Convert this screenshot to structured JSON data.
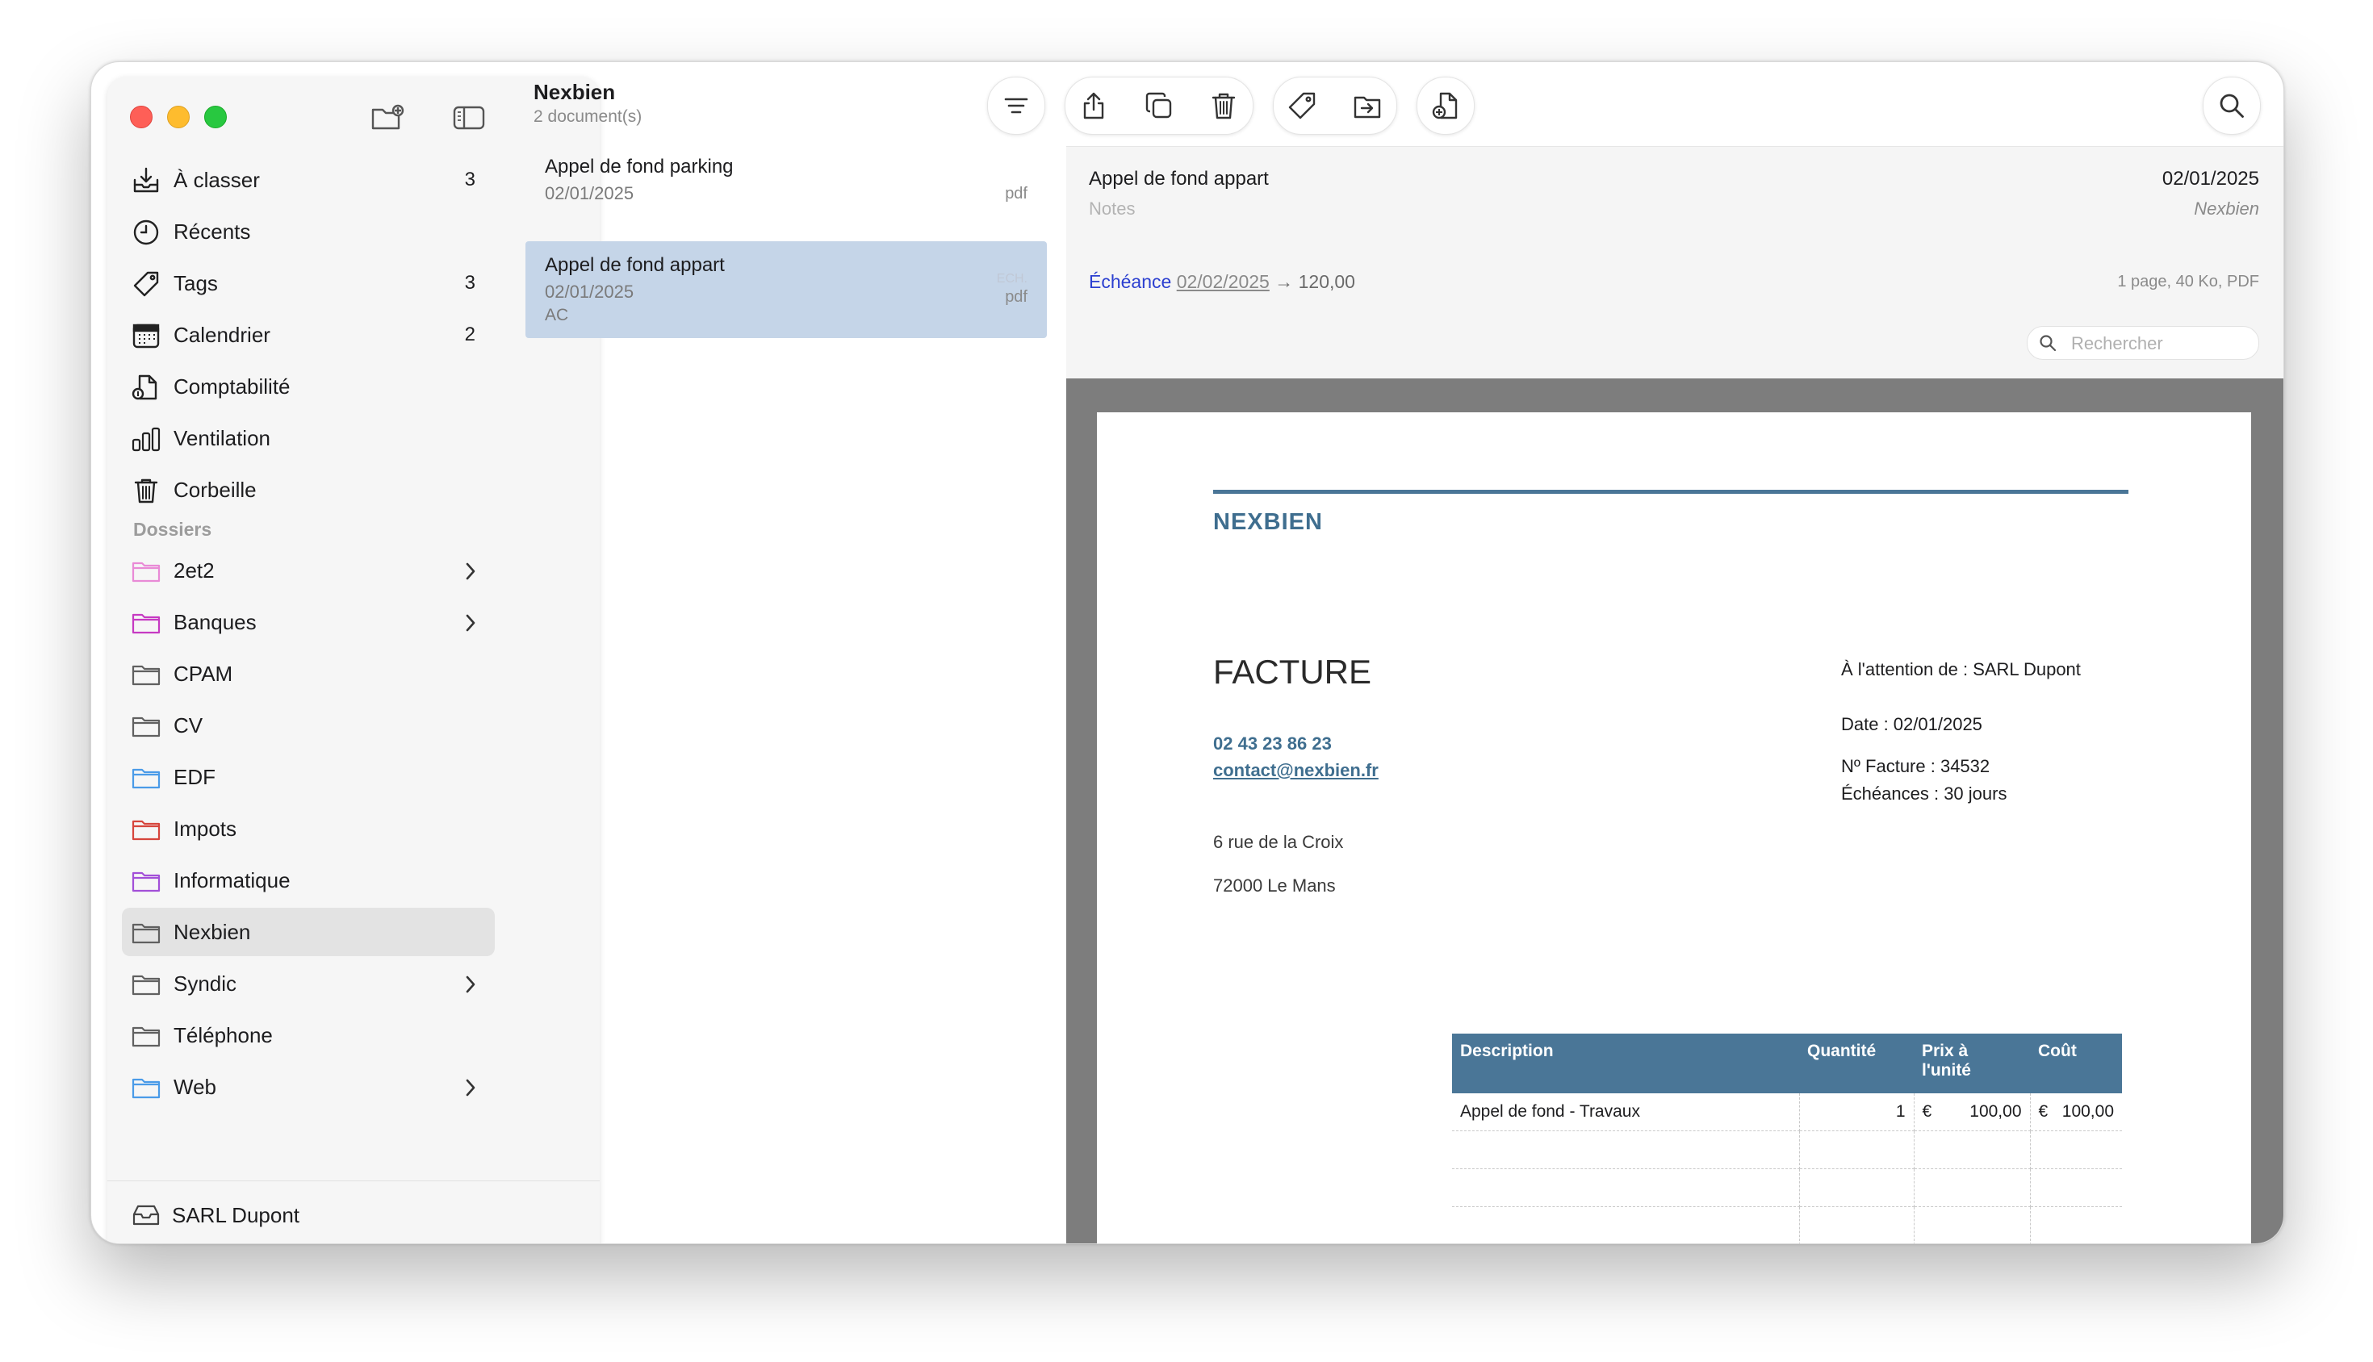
{
  "sidebar": {
    "items": [
      {
        "label": "À classer",
        "count": "3",
        "icon": "inbox-tray-icon"
      },
      {
        "label": "Récents",
        "count": "",
        "icon": "clock-icon"
      },
      {
        "label": "Tags",
        "count": "3",
        "icon": "tag-icon"
      },
      {
        "label": "Calendrier",
        "count": "2",
        "icon": "calendar-icon"
      },
      {
        "label": "Comptabilité",
        "count": "",
        "icon": "accounting-icon"
      },
      {
        "label": "Ventilation",
        "count": "",
        "icon": "bars-icon"
      },
      {
        "label": "Corbeille",
        "count": "",
        "icon": "trash-icon"
      }
    ],
    "section_title": "Dossiers",
    "folders": [
      {
        "label": "2et2",
        "color": "#e98ad6",
        "chevron": true
      },
      {
        "label": "Banques",
        "color": "#c63ac2",
        "chevron": true
      },
      {
        "label": "CPAM",
        "color": "#606060",
        "chevron": false
      },
      {
        "label": "CV",
        "color": "#606060",
        "chevron": false
      },
      {
        "label": "EDF",
        "color": "#4a9be8",
        "chevron": false
      },
      {
        "label": "Impots",
        "color": "#d6453c",
        "chevron": false
      },
      {
        "label": "Informatique",
        "color": "#a24fd8",
        "chevron": false
      },
      {
        "label": "Nexbien",
        "color": "#606060",
        "chevron": false,
        "selected": true
      },
      {
        "label": "Syndic",
        "color": "#606060",
        "chevron": true
      },
      {
        "label": "Téléphone",
        "color": "#606060",
        "chevron": false
      },
      {
        "label": "Web",
        "color": "#4a9be8",
        "chevron": true
      }
    ],
    "footer": "SARL Dupont"
  },
  "list": {
    "title": "Nexbien",
    "subtitle": "2 document(s)",
    "documents": [
      {
        "name": "Appel de fond parking",
        "date": "02/01/2025",
        "tag": "",
        "type": "pdf",
        "ech": ""
      },
      {
        "name": "Appel de fond appart",
        "date": "02/01/2025",
        "tag": "AC",
        "type": "pdf",
        "ech": "ECH."
      }
    ]
  },
  "detail": {
    "title": "Appel de fond appart",
    "notes_placeholder": "Notes",
    "date": "02/01/2025",
    "folder": "Nexbien",
    "echeance_label": "Échéance",
    "echeance_date": "02/02/2025",
    "echeance_amount": "→ 120,00",
    "info": "1 page, 40 Ko, PDF",
    "search_placeholder": "Rechercher"
  },
  "pdf": {
    "brand": "NEXBIEN",
    "doc_title": "FACTURE",
    "phone": "02 43 23 86 23",
    "email": "contact@nexbien.fr",
    "address_line1": "6 rue de la Croix",
    "address_line2": "72000 Le Mans",
    "attention": "À l'attention de : SARL Dupont",
    "date": "Date : 02/01/2025",
    "invoice_no": "Nº Facture : 34532",
    "terms": "Échéances : 30 jours",
    "table": {
      "headers": [
        "Description",
        "Quantité",
        "Prix à l'unité",
        "Coût"
      ],
      "rows": [
        {
          "description": "Appel de fond - Travaux",
          "quantity": "1",
          "unit_currency": "€",
          "unit_price": "100,00",
          "cost_currency": "€",
          "cost": "100,00"
        }
      ]
    }
  },
  "colors": {
    "accent": "#4a7697",
    "selection": "#c5d5e8",
    "link": "#2b3fd0"
  }
}
